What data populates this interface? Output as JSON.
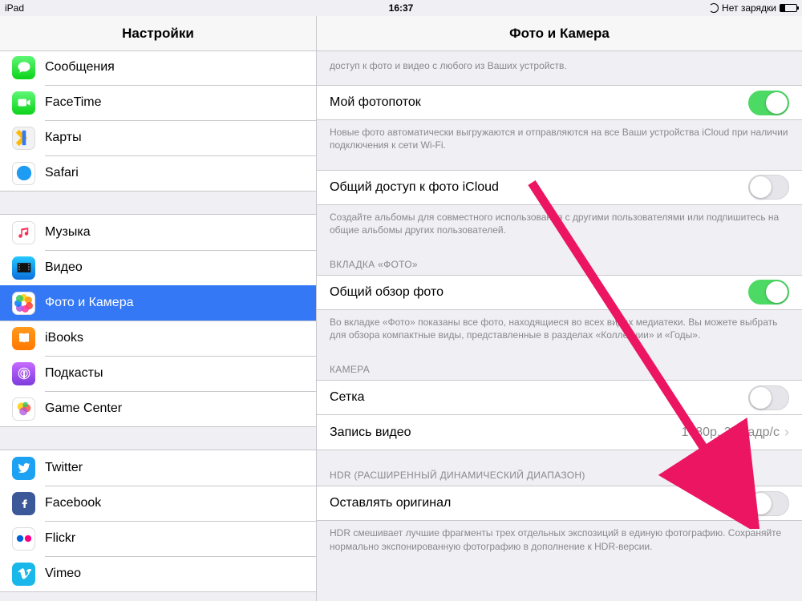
{
  "statusbar": {
    "device": "iPad",
    "time": "16:37",
    "charging_text": "Нет зарядки"
  },
  "sidebar": {
    "title": "Настройки",
    "groups": [
      {
        "items": [
          {
            "key": "messages",
            "label": "Сообщения"
          },
          {
            "key": "facetime",
            "label": "FaceTime"
          },
          {
            "key": "maps",
            "label": "Карты"
          },
          {
            "key": "safari",
            "label": "Safari"
          }
        ]
      },
      {
        "items": [
          {
            "key": "music",
            "label": "Музыка"
          },
          {
            "key": "video",
            "label": "Видео"
          },
          {
            "key": "photos",
            "label": "Фото и Камера",
            "selected": true
          },
          {
            "key": "ibooks",
            "label": "iBooks"
          },
          {
            "key": "podcasts",
            "label": "Подкасты"
          },
          {
            "key": "gamecenter",
            "label": "Game Center"
          }
        ]
      },
      {
        "items": [
          {
            "key": "twitter",
            "label": "Twitter"
          },
          {
            "key": "facebook",
            "label": "Facebook"
          },
          {
            "key": "flickr",
            "label": "Flickr"
          },
          {
            "key": "vimeo",
            "label": "Vimeo"
          }
        ]
      }
    ]
  },
  "detail": {
    "title": "Фото и Камера",
    "top_footer": "доступ к фото и видео с любого из Ваших устройств.",
    "photostream": {
      "label": "Мой фотопоток",
      "on": true,
      "footer": "Новые фото автоматически выгружаются и отправляются на все Ваши устройства iCloud при наличии подключения к сети Wi-Fi."
    },
    "sharing": {
      "label": "Общий доступ к фото iCloud",
      "on": false,
      "footer": "Создайте альбомы для совместного использования с другими пользователями или подпишитесь на общие альбомы других пользователей."
    },
    "tab": {
      "header": "ВКЛАДКА «ФОТО»",
      "summary_label": "Общий обзор фото",
      "summary_on": true,
      "footer": "Во вкладке «Фото» показаны все фото, находящиеся во всех видах медиатеки. Вы можете выбрать для обзора компактные виды, представленные в разделах «Коллекции» и «Годы»."
    },
    "camera": {
      "header": "КАМЕРА",
      "grid_label": "Сетка",
      "grid_on": false,
      "record_label": "Запись видео",
      "record_value": "1080p, 30 кадр/с"
    },
    "hdr": {
      "header": "HDR (РАСШИРЕННЫЙ ДИНАМИЧЕСКИЙ ДИАПАЗОН)",
      "keep_label": "Оставлять оригинал",
      "keep_on": false,
      "footer": "HDR смешивает лучшие фрагменты трех отдельных экспозиций в единую фотографию. Сохраняйте нормально экспонированную фотографию в дополнение к HDR-версии."
    }
  }
}
